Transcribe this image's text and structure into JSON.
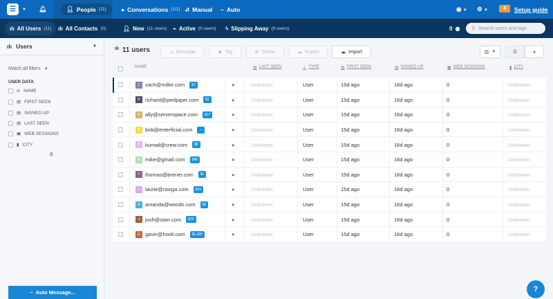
{
  "topbar": {
    "people": "People",
    "people_count": "(11)",
    "conversations": "Conversations",
    "conversations_count": "(1/1)",
    "manual": "Manual",
    "auto": "Auto",
    "badge": "4",
    "setup_guide": "Setup guide"
  },
  "subbar": {
    "all_users": "All Users",
    "all_users_count": "(11)",
    "all_contacts": "All Contacts",
    "all_contacts_count": "(0)",
    "new": "New",
    "new_count": "(11 users)",
    "active": "Active",
    "active_count": "(0 users)",
    "slipping": "Slipping Away",
    "slipping_count": "(0 users)",
    "views": "0",
    "search_placeholder": "Search users and tags"
  },
  "sidebar": {
    "title": "Users",
    "match": "Match all filters",
    "section": "USER DATA",
    "filters": [
      "NAME",
      "FIRST SEEN",
      "SIGNED UP",
      "LAST SEEN",
      "WEB SESSIONS",
      "CITY"
    ],
    "auto_message": "Auto Message..."
  },
  "toolbar": {
    "count": "11 users",
    "message": "Message",
    "tag": "Tag",
    "delete": "Delete",
    "export": "Export",
    "import": "Import"
  },
  "columns": {
    "name": "NAME",
    "last_seen": "LAST SEEN",
    "type": "TYPE",
    "first_seen": "FIRST SEEN",
    "signed_up": "SIGNED UP",
    "web_sessions": "WEB SESSIONS",
    "city": "CITY"
  },
  "rows": [
    {
      "initial": "Z",
      "email": "zach@miller.com",
      "tag": "$7",
      "color": "#8e7aa8",
      "last_seen": "Unknown",
      "type": "User",
      "first_seen": "15d ago",
      "signed_up": "16d ago",
      "web_sessions": "0",
      "city": "Unknown"
    },
    {
      "initial": "R",
      "email": "richard@piedpiper.com",
      "tag": "$1",
      "color": "#4a4e6a",
      "last_seen": "Unknown",
      "type": "User",
      "first_seen": "15d ago",
      "signed_up": "16d ago",
      "web_sessions": "0",
      "city": "Unknown"
    },
    {
      "initial": "A",
      "email": "ally@serverspace.com",
      "tag": "$17",
      "color": "#d9b46a",
      "last_seen": "Unknown",
      "type": "User",
      "first_seen": "15d ago",
      "signed_up": "16d ago",
      "web_sessions": "0",
      "city": "Unknown"
    },
    {
      "initial": "B",
      "email": "bob@enterficial.com",
      "tag": "---",
      "color": "#f5dd3d",
      "last_seen": "Unknown",
      "type": "User",
      "first_seen": "15d ago",
      "signed_up": "16d ago",
      "web_sessions": "0",
      "city": "Unknown"
    },
    {
      "initial": "K",
      "email": "kumail@crew.com",
      "tag": "$8",
      "color": "#eeb5f2",
      "last_seen": "Unknown",
      "type": "User",
      "first_seen": "15d ago",
      "signed_up": "16d ago",
      "web_sessions": "0",
      "city": "Unknown"
    },
    {
      "initial": "M",
      "email": "mike@gmail.com",
      "tag": "$48",
      "color": "#a8e2b0",
      "last_seen": "Unknown",
      "type": "User",
      "first_seen": "15d ago",
      "signed_up": "16d ago",
      "web_sessions": "0",
      "city": "Unknown"
    },
    {
      "initial": "T",
      "email": "thomas@brener.com",
      "tag": "$1",
      "color": "#8a6480",
      "last_seen": "Unknown",
      "type": "User",
      "first_seen": "15d ago",
      "signed_up": "16d ago",
      "web_sessions": "0",
      "city": "Unknown"
    },
    {
      "initial": "L",
      "email": "laurie@raviga.com",
      "tag": "$16",
      "color": "#d8aaf0",
      "last_seen": "Unknown",
      "type": "User",
      "first_seen": "15d ago",
      "signed_up": "16d ago",
      "web_sessions": "0",
      "city": "Unknown"
    },
    {
      "initial": "A",
      "email": "amanda@woods.com",
      "tag": "$3",
      "color": "#4fb0e0",
      "last_seen": "Unknown",
      "type": "User",
      "first_seen": "15d ago",
      "signed_up": "16d ago",
      "web_sessions": "0",
      "city": "Unknown"
    },
    {
      "initial": "J",
      "email": "josh@starr.com",
      "tag": "$19",
      "color": "#a0623c",
      "last_seen": "Unknown",
      "type": "User",
      "first_seen": "15d ago",
      "signed_up": "16d ago",
      "web_sessions": "0",
      "city": "Unknown"
    },
    {
      "initial": "G",
      "email": "gavin@hooli.com",
      "tag": "$1,000",
      "color": "#b86a3c",
      "last_seen": "Unknown",
      "type": "User",
      "first_seen": "15d ago",
      "signed_up": "16d ago",
      "web_sessions": "0",
      "city": "Unknown"
    }
  ],
  "help": "?"
}
